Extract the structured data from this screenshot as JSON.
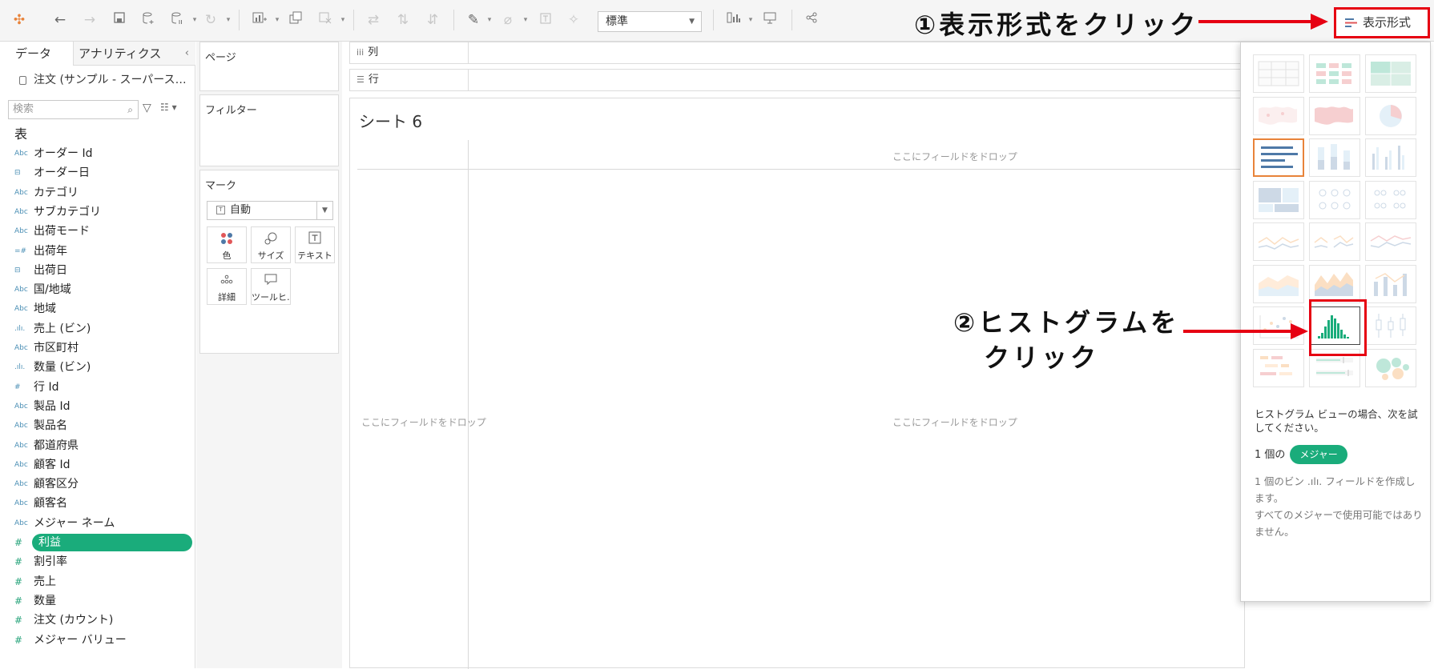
{
  "toolbar": {
    "fit_select": "標準",
    "show_me_label": "表示形式"
  },
  "annotations": {
    "step1": "①表示形式をクリック",
    "step2_line1": "②ヒストグラムを",
    "step2_line2": "クリック"
  },
  "data_pane": {
    "tabs": {
      "data": "データ",
      "analytics": "アナリティクス"
    },
    "datasource": "注文 (サンプル - スーパース…",
    "search_placeholder": "検索",
    "section_title": "表",
    "fields": [
      {
        "icon": "Abc",
        "name": "オーダー Id",
        "type": "dimension"
      },
      {
        "icon": "⊟",
        "name": "オーダー日",
        "type": "dimension"
      },
      {
        "icon": "Abc",
        "name": "カテゴリ",
        "type": "dimension"
      },
      {
        "icon": "Abc",
        "name": "サブカテゴリ",
        "type": "dimension"
      },
      {
        "icon": "Abc",
        "name": "出荷モード",
        "type": "dimension"
      },
      {
        "icon": "=#",
        "name": "出荷年",
        "type": "dimension"
      },
      {
        "icon": "⊟",
        "name": "出荷日",
        "type": "dimension"
      },
      {
        "icon": "Abc",
        "name": "国/地域",
        "type": "dimension"
      },
      {
        "icon": "Abc",
        "name": "地域",
        "type": "dimension"
      },
      {
        "icon": ".ılı.",
        "name": "売上 (ビン)",
        "type": "dimension"
      },
      {
        "icon": "Abc",
        "name": "市区町村",
        "type": "dimension"
      },
      {
        "icon": ".ılı.",
        "name": "数量 (ビン)",
        "type": "dimension"
      },
      {
        "icon": "#",
        "name": "行 Id",
        "type": "dimension"
      },
      {
        "icon": "Abc",
        "name": "製品 Id",
        "type": "dimension"
      },
      {
        "icon": "Abc",
        "name": "製品名",
        "type": "dimension"
      },
      {
        "icon": "Abc",
        "name": "都道府県",
        "type": "dimension"
      },
      {
        "icon": "Abc",
        "name": "顧客 Id",
        "type": "dimension"
      },
      {
        "icon": "Abc",
        "name": "顧客区分",
        "type": "dimension"
      },
      {
        "icon": "Abc",
        "name": "顧客名",
        "type": "dimension"
      },
      {
        "icon": "Abc",
        "name": "メジャー ネーム",
        "type": "dimension"
      },
      {
        "icon": "#",
        "name": "利益",
        "type": "measure",
        "selected": true
      },
      {
        "icon": "#",
        "name": "割引率",
        "type": "measure"
      },
      {
        "icon": "#",
        "name": "売上",
        "type": "measure"
      },
      {
        "icon": "#",
        "name": "数量",
        "type": "measure"
      },
      {
        "icon": "#",
        "name": "注文 (カウント)",
        "type": "measure"
      },
      {
        "icon": "#",
        "name": "メジャー バリュー",
        "type": "measure"
      }
    ]
  },
  "cards": {
    "pages": "ページ",
    "filters": "フィルター",
    "marks": "マーク",
    "marks_type": "自動",
    "mark_buttons": [
      {
        "icon": "color-icon",
        "label": "色"
      },
      {
        "icon": "size-icon",
        "label": "サイズ"
      },
      {
        "icon": "text-icon",
        "label": "テキスト"
      },
      {
        "icon": "detail-icon",
        "label": "詳細"
      },
      {
        "icon": "tooltip-icon",
        "label": "ツールヒ…"
      }
    ]
  },
  "shelves": {
    "columns": "列",
    "rows": "行"
  },
  "worksheet": {
    "title": "シート 6",
    "drop_hint": "ここにフィールドをドロップ"
  },
  "show_me": {
    "hint": "ヒストグラム ビューの場合、次を試してください。",
    "requirement_prefix": "1 個の",
    "requirement_pill": "メジャー",
    "note_line1": "1 個のビン .ılı. フィールドを作成します。",
    "note_line2": "すべてのメジャーで使用可能ではありません。",
    "thumbnails": [
      "text-table",
      "heat-map",
      "highlight-table",
      "symbol-map",
      "filled-map",
      "pie-chart",
      "horizontal-bars",
      "stacked-bars",
      "side-by-side-bars",
      "treemap",
      "circle-views",
      "side-by-side-circles",
      "lines-continuous",
      "lines-discrete",
      "dual-lines",
      "area-continuous",
      "area-discrete",
      "dual-combination",
      "scatter-plot",
      "histogram",
      "box-and-whisker",
      "gantt-chart",
      "bullet-graph",
      "packed-bubbles"
    ],
    "active_thumbnail": "horizontal-bars",
    "selected_thumbnail": "histogram"
  },
  "colors": {
    "accent_green": "#1aac7b",
    "annotation_red": "#e60012",
    "active_orange": "#e8833a"
  }
}
